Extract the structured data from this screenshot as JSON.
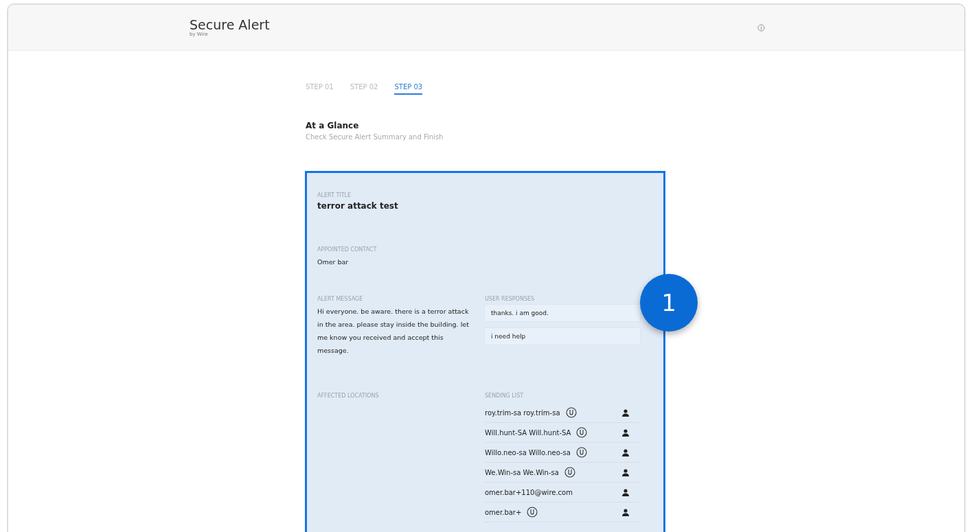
{
  "header": {
    "title": "Secure Alert",
    "subtitle": "by Wire"
  },
  "steps": [
    {
      "label": "STEP 01",
      "selected": false
    },
    {
      "label": "STEP 02",
      "selected": false
    },
    {
      "label": "STEP 03",
      "selected": true
    }
  ],
  "section": {
    "title": "At a Glance",
    "subtitle": "Check Secure Alert Summary and Finish"
  },
  "summary": {
    "alert_title": {
      "label": "ALERT TITLE",
      "value": "terror attack test"
    },
    "appointed_contact": {
      "label": "APPOINTED CONTACT",
      "value": "Omer bar"
    },
    "alert_message": {
      "label": "ALERT MESSAGE",
      "value": "Hi everyone. be aware. there is a terror attack in the area. please stay inside the building. let me know you received and accept this message."
    },
    "user_responses": {
      "label": "USER RESPONSES",
      "items": [
        "thanks. i am good.",
        "i need help"
      ]
    },
    "affected_locations": {
      "label": "AFFECTED LOCATIONS"
    },
    "sending_list": {
      "label": "SENDING LIST",
      "items": [
        {
          "name": "roy.trim-sa roy.trim-sa",
          "verified": true
        },
        {
          "name": "Will.hunt-SA Will.hunt-SA",
          "verified": true
        },
        {
          "name": "Willo.neo-sa Willo.neo-sa",
          "verified": true
        },
        {
          "name": "We.Win-sa We.Win-sa",
          "verified": true
        },
        {
          "name": "omer.bar+110@wire.com",
          "verified": false
        },
        {
          "name": "omer.bar+",
          "verified": true
        }
      ]
    }
  },
  "callout_badge": "1"
}
